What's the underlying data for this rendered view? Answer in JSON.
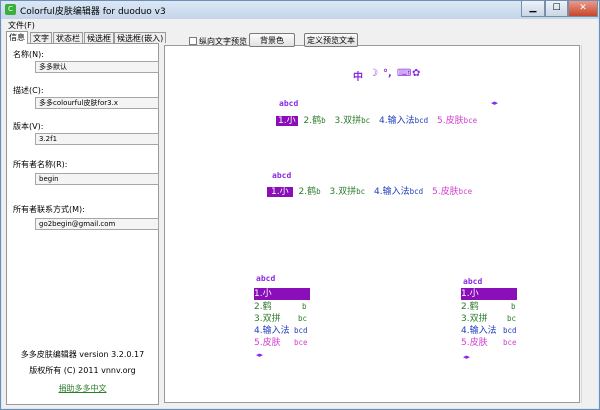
{
  "window": {
    "title": "Colorful皮肤编辑器 for duoduo v3",
    "app_icon": "C"
  },
  "menu": {
    "file": "文件(F)"
  },
  "tabs": [
    "信息",
    "文字",
    "状态栏",
    "候选框",
    "候选框(嵌入)"
  ],
  "info": {
    "name_label": "名称(N):",
    "name_value": "多多默认",
    "desc_label": "描述(C):",
    "desc_value": "多多colourful皮肤for3.x",
    "version_label": "版本(V):",
    "version_value": "3.2f1",
    "owner_label": "所有者名称(R):",
    "owner_value": "begin",
    "contact_label": "所有者联系方式(M):",
    "contact_value": "go2begin@gmail.com",
    "footer_version": "多多皮肤编辑器 version 3.2.0.17",
    "footer_copyright": "版权所有 (C) 2011 vnnv.org",
    "footer_link": "捐助多多中文"
  },
  "toolbar": {
    "vertical_preview": "纵向文字预览",
    "background_btn": "背景色",
    "custom_text_btn": "定义预览文本"
  },
  "status_icons": [
    "中",
    "☽",
    "°,",
    "⌨",
    "✿"
  ],
  "preview": {
    "code": "abcd",
    "arrows": "◂▸",
    "candidates": [
      {
        "num": "1.",
        "word": "小",
        "hint": ""
      },
      {
        "num": "2.",
        "word": "鹤",
        "hint": "b"
      },
      {
        "num": "3.",
        "word": "双拼",
        "hint": "bc"
      },
      {
        "num": "4.",
        "word": "输入法",
        "hint": "bcd"
      },
      {
        "num": "5.",
        "word": "皮肤",
        "hint": "bce"
      }
    ],
    "colors": {
      "c1": "#ffffff",
      "c2": "#2a7d2a",
      "c3": "#2a7d2a",
      "c4": "#1f3fbf",
      "c5": "#d13fd1",
      "sel_bg": "#8a0fb8",
      "code": "#8a2be2"
    }
  }
}
